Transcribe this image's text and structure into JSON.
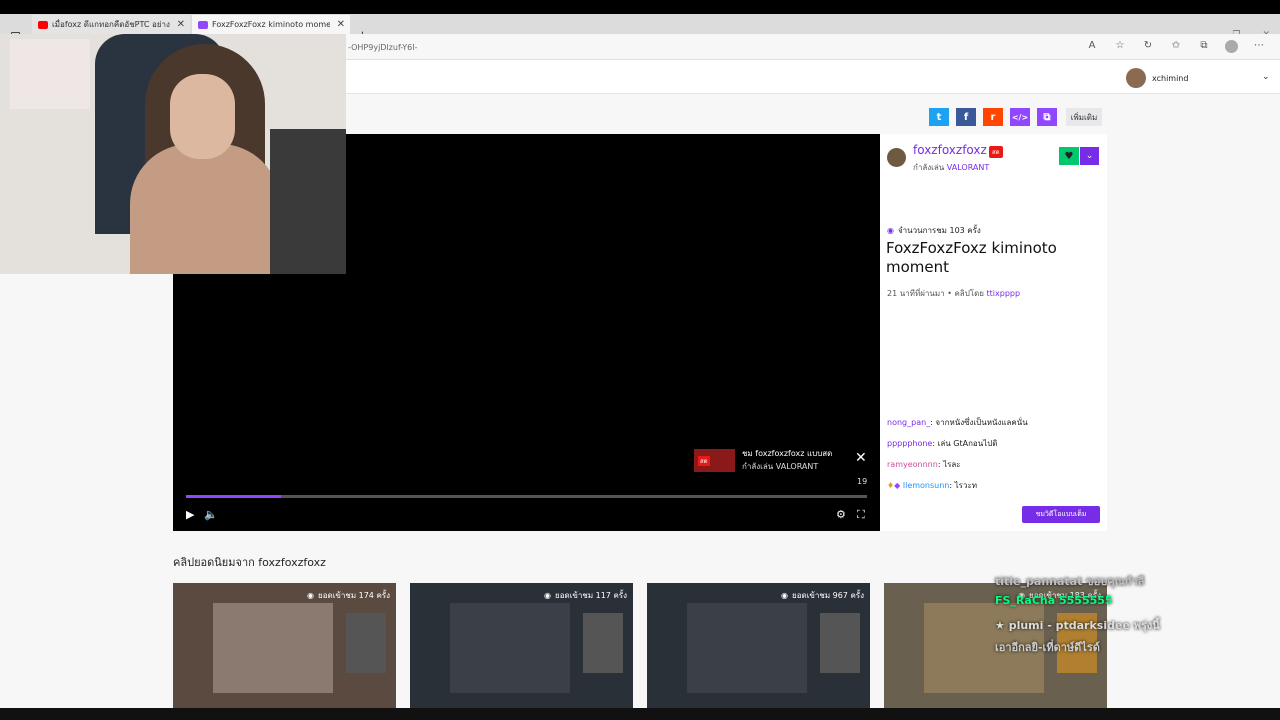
{
  "browser": {
    "tabs": [
      {
        "label": "เมื่อfoxz ดีแกทอกคืดอัชPTC อย่างนั้น",
        "favicon_color": "#ff0000",
        "active": false
      },
      {
        "label": "FoxzFoxzFoxz kiminoto moment",
        "favicon_color": "#9146ff",
        "active": true
      }
    ],
    "new_tab": "+",
    "url": "-OHP9yjDlzuf-Y6I-",
    "window_controls": [
      "—",
      "❐",
      "✕"
    ]
  },
  "header": {
    "username": "xchimind",
    "chevron": "⌄"
  },
  "share": {
    "buttons": [
      {
        "name": "twitter",
        "glyph": "t",
        "color": "#1da1f2"
      },
      {
        "name": "facebook",
        "glyph": "f",
        "color": "#3b5998"
      },
      {
        "name": "reddit",
        "glyph": "r",
        "color": "#ff4500"
      },
      {
        "name": "embed",
        "glyph": "</>",
        "color": "#9146ff"
      },
      {
        "name": "copy",
        "glyph": "⧉",
        "color": "#9146ff"
      }
    ],
    "more_label": "เพิ่มเติม"
  },
  "player": {
    "promo_line1": "ชม foxzfoxzfoxz แบบสด",
    "promo_line2": "กำลังเล่น VALORANT",
    "promo_badge": "สด",
    "close_glyph": "✕",
    "timestamp": "19",
    "progress": 0.14,
    "play_glyph": "▶",
    "volume_glyph": "🔈",
    "settings_glyph": "⚙",
    "fullscreen_glyph": "⛶"
  },
  "channel": {
    "name": "foxzfoxzfoxz",
    "live_badge": "สด",
    "game_prefix": "กำลังเล่น",
    "game": "VALORANT",
    "follow_glyph": "♥",
    "follow_more_glyph": "⌄"
  },
  "clip": {
    "views": "จำนวนการชม 103 ครั้ง",
    "title": "FoxzFoxzFoxz kiminoto moment",
    "meta_prefix": "21 นาทีที่ผ่านมา • คลิปโดย",
    "clipper": "ttixpppp"
  },
  "chat": [
    {
      "user": "nong_pan_",
      "color": "#772ce8",
      "message": "จากหนังซึ่งเป็นหนังแลคนั่น"
    },
    {
      "user": "ppppphone",
      "color": "#772ce8",
      "message": "เล่น GtAกอนไปดิ"
    },
    {
      "user": "ramyeonnnn",
      "color": "#cf4c9f",
      "message": "ไรละ"
    },
    {
      "user": "llemonsunn",
      "color": "#1e90ff",
      "message": "ไรวะท"
    }
  ],
  "watch_button": "ชมวิดีโอแบบเต็ม",
  "popular": {
    "title": "คลิปยอดนิยมจาก foxzfoxzfoxz",
    "clips": [
      {
        "views": "ยอดเข้าชม 174 ครั้ง",
        "color": "#5a4a40"
      },
      {
        "views": "ยอดเข้าชม 117 ครั้ง",
        "color": "#2a3038"
      },
      {
        "views": "ยอดเข้าชม 967 ครั้ง",
        "color": "#2a3038"
      },
      {
        "views": "ยอดเข้าชม 183 ครั้ง",
        "color": "#6a6050"
      }
    ]
  },
  "overlay": [
    {
      "text": "title_pannatat ขอบคุณกำลี",
      "color": "#c0c0c0"
    },
    {
      "text": "FS_RaCha 5555555",
      "color": "#00ff7f"
    },
    {
      "text": "★ plumi - ptdarksidee พรุ่งนี้",
      "color": "#dddddd"
    },
    {
      "text": "เอาอีกลยิ-เที่ดาษ์ดีไรด์",
      "color": "#cccccc"
    }
  ]
}
